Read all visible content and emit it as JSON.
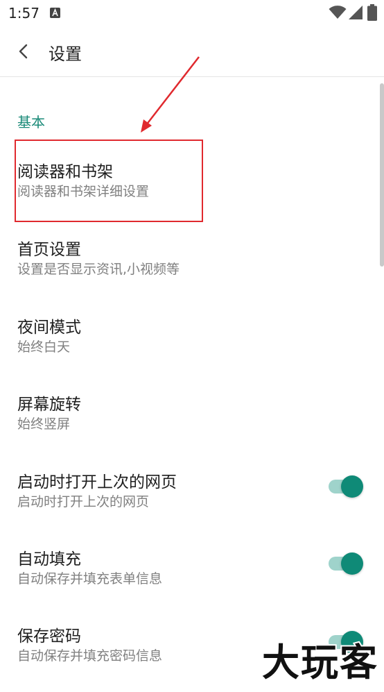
{
  "status_bar": {
    "time": "1:57",
    "icons": [
      "notification-a-icon",
      "wifi-icon",
      "signal-icon",
      "battery-icon"
    ]
  },
  "app_bar": {
    "back_icon": "chevron-left-icon",
    "title": "设置"
  },
  "section": {
    "header": "基本",
    "accent_color": "#1a8a78"
  },
  "items": [
    {
      "title": "阅读器和书架",
      "summary": "阅读器和书架详细设置"
    },
    {
      "title": "首页设置",
      "summary": "设置是否显示资讯,小视频等"
    },
    {
      "title": "夜间模式",
      "summary": "始终白天"
    },
    {
      "title": "屏幕旋转",
      "summary": "始终竖屏"
    },
    {
      "title": "启动时打开上次的网页",
      "summary": "启动时打开上次的网页",
      "toggle": true
    },
    {
      "title": "自动填充",
      "summary": "自动保存并填充表单信息",
      "toggle": true
    },
    {
      "title": "保存密码",
      "summary": "自动保存并填充密码信息",
      "toggle": true
    }
  ],
  "annotation": {
    "highlight_color": "#e0292e"
  },
  "watermark": "大玩客"
}
